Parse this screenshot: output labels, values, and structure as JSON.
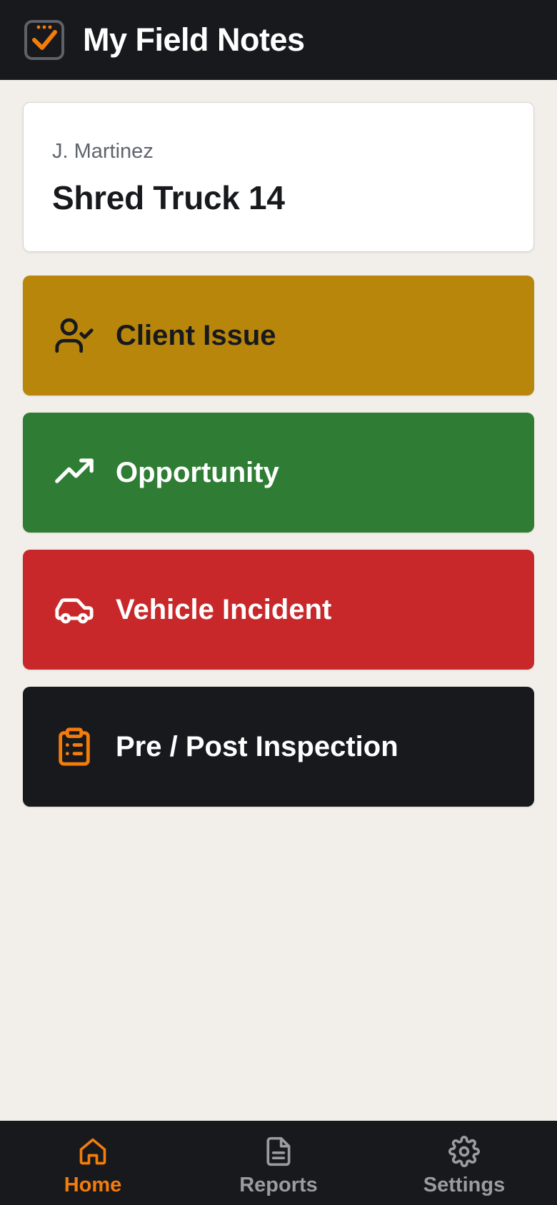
{
  "header": {
    "title": "My Field Notes",
    "logo_icon": "checkbox-check-icon",
    "background": "#17191d",
    "accent": "#f47c0a"
  },
  "profile": {
    "user_name": "J. Martinez",
    "vehicle_name": "Shred Truck 14"
  },
  "actions": [
    {
      "label": "Client Issue",
      "icon": "user-check-icon",
      "color": "#b8860b"
    },
    {
      "label": "Opportunity",
      "icon": "trending-up-icon",
      "color": "#2f7d34"
    },
    {
      "label": "Vehicle Incident",
      "icon": "car-icon",
      "color": "#c8282a"
    },
    {
      "label": "Pre / Post Inspection",
      "icon": "clipboard-list-icon",
      "color": "#17191d"
    }
  ],
  "bottom_nav": {
    "active": "Home",
    "items": [
      {
        "label": "Home",
        "icon": "home-icon"
      },
      {
        "label": "Reports",
        "icon": "document-icon"
      },
      {
        "label": "Settings",
        "icon": "gear-icon"
      }
    ]
  }
}
